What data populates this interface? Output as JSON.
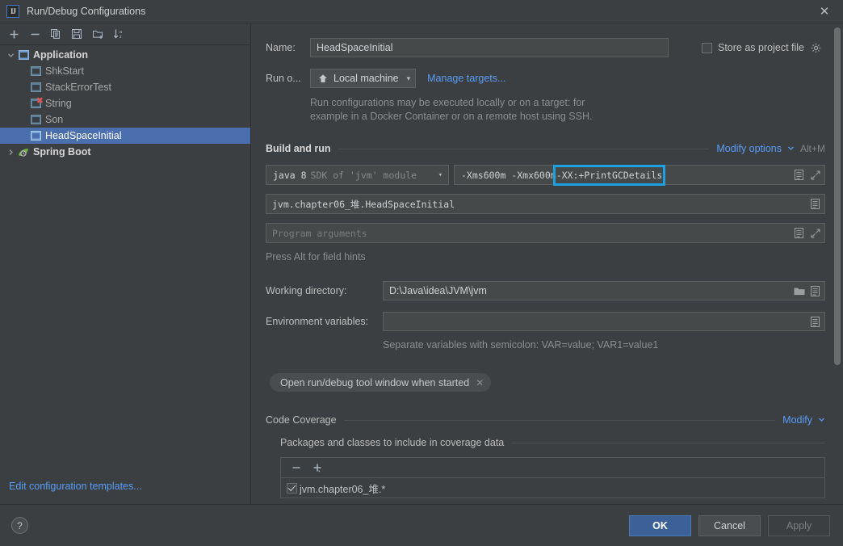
{
  "window": {
    "title": "Run/Debug Configurations",
    "logo_text": "IJ",
    "close_icon": "close-icon"
  },
  "sidebar": {
    "toolbar": [
      {
        "name": "add-button",
        "icon": "plus-icon"
      },
      {
        "name": "remove-button",
        "icon": "minus-icon"
      },
      {
        "name": "copy-button",
        "icon": "copy-icon"
      },
      {
        "name": "save-button",
        "icon": "save-icon"
      },
      {
        "name": "new-folder-button",
        "icon": "folder-add-icon"
      },
      {
        "name": "sort-button",
        "icon": "sort-az-icon"
      }
    ],
    "tree": [
      {
        "label": "Application",
        "type": "group",
        "expanded": true,
        "icon": "application-icon"
      },
      {
        "label": "ShkStart",
        "type": "child",
        "icon": "application-icon"
      },
      {
        "label": "StackErrorTest",
        "type": "child",
        "icon": "application-icon"
      },
      {
        "label": "String",
        "type": "child",
        "icon": "application-icon",
        "error": true,
        "error_glyph": "✖"
      },
      {
        "label": "Son",
        "type": "child",
        "icon": "application-icon"
      },
      {
        "label": "HeadSpaceInitial",
        "type": "child",
        "icon": "application-icon",
        "selected": true
      },
      {
        "label": "Spring Boot",
        "type": "group",
        "expanded": false,
        "icon": "spring-boot-icon"
      }
    ],
    "footer_link": "Edit configuration templates..."
  },
  "main": {
    "name": {
      "label": "Name:",
      "value": "HeadSpaceInitial"
    },
    "store_as_project_file": {
      "label": "Store as project file",
      "checked": false,
      "gear_icon": "gear-icon"
    },
    "run_on": {
      "label": "Run o...",
      "value": "Local machine",
      "machine_icon": "machine-icon",
      "chevron": "▾",
      "manage_link": "Manage targets..."
    },
    "run_on_hint_line1": "Run configurations may be executed locally or on a target: for",
    "run_on_hint_line2": "example in a Docker Container or on a remote host using SSH.",
    "build_and_run": {
      "title": "Build and run",
      "modify_options": "Modify options",
      "modify_chevron": "⌵",
      "shortcut": "Alt+M",
      "sdk": {
        "main": "java 8",
        "sub": "SDK of 'jvm' module",
        "chevron": "▾"
      },
      "vm_options_prefix": "-Xms600m -Xmx600m ",
      "vm_options_highlighted": "-XX:+PrintGCDetails",
      "main_class": "jvm.chapter06_堆.HeadSpaceInitial",
      "program_args_placeholder": "Program arguments",
      "press_alt_hint": "Press Alt for field hints"
    },
    "working_directory": {
      "label": "Working directory:",
      "value": "D:\\Java\\idea\\JVM\\jvm"
    },
    "environment_variables": {
      "label": "Environment variables:",
      "value": ""
    },
    "env_note": "Separate variables with semicolon: VAR=value; VAR1=value1",
    "chip": {
      "label": "Open run/debug tool window when started",
      "remove_glyph": "✕"
    },
    "code_coverage": {
      "title": "Code Coverage",
      "modify_link": "Modify",
      "modify_chevron": "⌵",
      "packages_title": "Packages and classes to include in coverage data",
      "toolbar": [
        {
          "name": "coverage-remove-button",
          "icon": "minus-icon"
        },
        {
          "name": "coverage-add-button",
          "icon": "plus-icon"
        }
      ],
      "items": [
        {
          "label": "jvm.chapter06_堆.*",
          "checked": true
        }
      ]
    }
  },
  "footer": {
    "help_glyph": "?",
    "ok": "OK",
    "cancel": "Cancel",
    "apply": "Apply"
  },
  "colors": {
    "accent_link": "#589df6",
    "selection": "#4b6eaf",
    "annotation": "#1ba1e2",
    "primary_button": "#3c6199",
    "error": "#e05555",
    "background": "#3c3f41"
  }
}
